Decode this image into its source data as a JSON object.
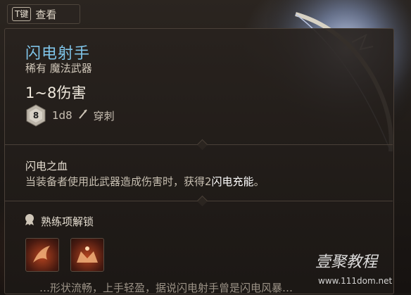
{
  "hint": {
    "key": "T键",
    "label": "查看"
  },
  "item": {
    "name": "闪电射手",
    "rarity_type": "稀有 魔法武器",
    "damage": "1~8伤害",
    "dice_face": "8",
    "dice": "1d8",
    "damage_type": "穿刺"
  },
  "passive": {
    "name": "闪电之血",
    "desc_pre": "当装备者使用此武器造成伤害时，获得2",
    "desc_highlight": "闪电充能",
    "desc_post": "。"
  },
  "proficiency": {
    "label": "熟练项解锁"
  },
  "footer": {
    "text": "…形状流畅，上手轻盈，据说闪电射手曾是闪电风暴…"
  },
  "watermark": {
    "title": "壹聚教程",
    "url": "www.111dom.net"
  },
  "colors": {
    "title": "#7fc4e8",
    "panel": "#1c1815",
    "accent": "#b3431f"
  },
  "icons": {
    "dice": "d8-dice-icon",
    "damage_type": "pierce-arrow-icon",
    "proficiency": "proficiency-medal-icon"
  }
}
